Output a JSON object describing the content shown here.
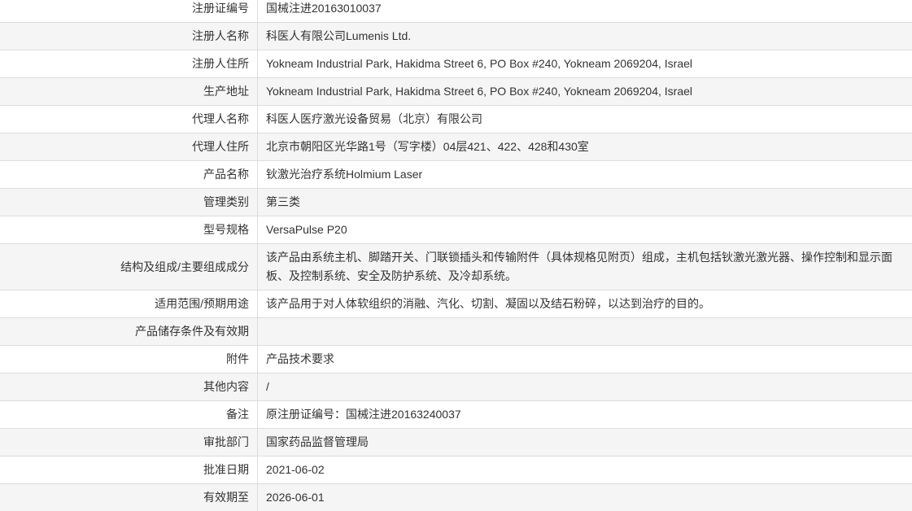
{
  "colors": {
    "text": "#333333",
    "border": "#dddddd",
    "stripe": "#f5f5f5",
    "background": "#ffffff"
  },
  "rows": [
    {
      "label": "注册证编号",
      "value": "国械注进20163010037"
    },
    {
      "label": "注册人名称",
      "value": "科医人有限公司Lumenis Ltd."
    },
    {
      "label": "注册人住所",
      "value": "Yokneam Industrial Park, Hakidma Street 6, PO Box #240, Yokneam 2069204, Israel"
    },
    {
      "label": "生产地址",
      "value": "Yokneam Industrial Park, Hakidma Street 6, PO Box #240, Yokneam 2069204, Israel"
    },
    {
      "label": "代理人名称",
      "value": "科医人医疗激光设备贸易（北京）有限公司"
    },
    {
      "label": "代理人住所",
      "value": "北京市朝阳区光华路1号（写字楼）04层421、422、428和430室"
    },
    {
      "label": "产品名称",
      "value": "钬激光治疗系统Holmium Laser"
    },
    {
      "label": "管理类别",
      "value": "第三类"
    },
    {
      "label": "型号规格",
      "value": "VersaPulse P20"
    },
    {
      "label": "结构及组成/主要组成成分",
      "value": "该产品由系统主机、脚踏开关、门联锁插头和传输附件（具体规格见附页）组成，主机包括钬激光激光器、操作控制和显示面板、及控制系统、安全及防护系统、及冷却系统。"
    },
    {
      "label": "适用范围/预期用途",
      "value": "该产品用于对人体软组织的消融、汽化、切割、凝固以及结石粉碎，以达到治疗的目的。"
    },
    {
      "label": "产品储存条件及有效期",
      "value": ""
    },
    {
      "label": "附件",
      "value": "产品技术要求"
    },
    {
      "label": "其他内容",
      "value": "/"
    },
    {
      "label": "备注",
      "value": "原注册证编号：国械注进20163240037"
    },
    {
      "label": "审批部门",
      "value": "国家药品监督管理局"
    },
    {
      "label": "批准日期",
      "value": "2021-06-02"
    },
    {
      "label": "有效期至",
      "value": "2026-06-01"
    }
  ]
}
